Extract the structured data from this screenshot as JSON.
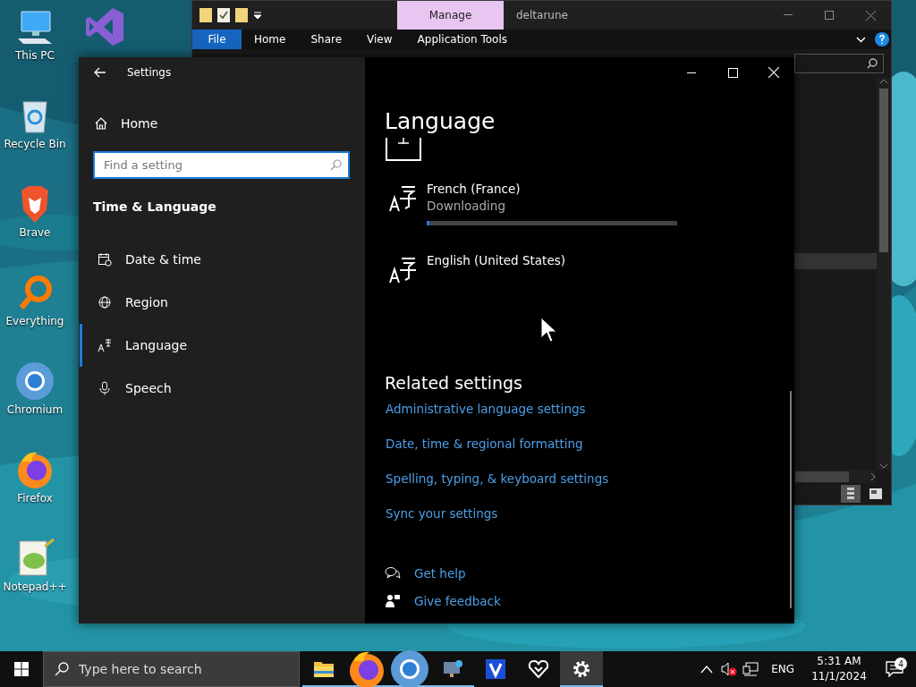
{
  "desktop": {
    "columns": [
      [
        {
          "kind": "pc",
          "label": "This PC"
        },
        {
          "kind": "bin",
          "label": "Recycle Bin"
        },
        {
          "kind": "lion",
          "label": "Brave"
        },
        {
          "kind": "magnifier",
          "label": "Everything"
        },
        {
          "kind": "ring",
          "label": "Chromium"
        },
        {
          "kind": "fox",
          "label": "Firefox"
        },
        {
          "kind": "notepad",
          "label": "Notepad++"
        }
      ],
      [
        {
          "kind": "vs"
        }
      ]
    ]
  },
  "explorer": {
    "context_tab": "Manage",
    "title": "deltarune",
    "file_menu": "File",
    "ribbon_tabs": [
      "Home",
      "Share",
      "View",
      "Application Tools"
    ]
  },
  "settings": {
    "title": "Settings",
    "home": "Home",
    "search": {
      "placeholder": "Find a setting"
    },
    "category": "Time & Language",
    "nav": [
      {
        "kind": "calendar",
        "label": "Date & time",
        "selected": false
      },
      {
        "kind": "globe",
        "label": "Region",
        "selected": false
      },
      {
        "kind": "language",
        "label": "Language",
        "selected": true
      },
      {
        "kind": "mic",
        "label": "Speech",
        "selected": false
      }
    ],
    "heading": "Language",
    "languages": [
      {
        "name": "French (France)",
        "status": "Downloading",
        "level": 0.01
      },
      {
        "name": "English (United States)"
      }
    ],
    "related_heading": "Related settings",
    "related_links": [
      "Administrative language settings",
      "Date, time & regional formatting",
      "Spelling, typing, & keyboard settings",
      "Sync your settings"
    ],
    "help_links": [
      {
        "kind": "help",
        "label": "Get help"
      },
      {
        "kind": "feedback",
        "label": "Give feedback"
      }
    ]
  },
  "taskbar": {
    "search_placeholder": "Type here to search",
    "apps": [
      {
        "kind": "folder",
        "running": true,
        "active": false
      },
      {
        "kind": "fox",
        "running": true,
        "active": false
      },
      {
        "kind": "ring",
        "running": true,
        "active": false
      },
      {
        "kind": "monitor",
        "running": true,
        "active": false
      },
      {
        "kind": "vlogo",
        "running": false,
        "active": false
      },
      {
        "kind": "heart",
        "running": false,
        "active": false
      },
      {
        "kind": "gear",
        "running": true,
        "active": true
      }
    ],
    "volume_muted": true,
    "language": "ENG",
    "time": "5:31 AM",
    "date": "11/1/2024",
    "notifications": "4"
  }
}
